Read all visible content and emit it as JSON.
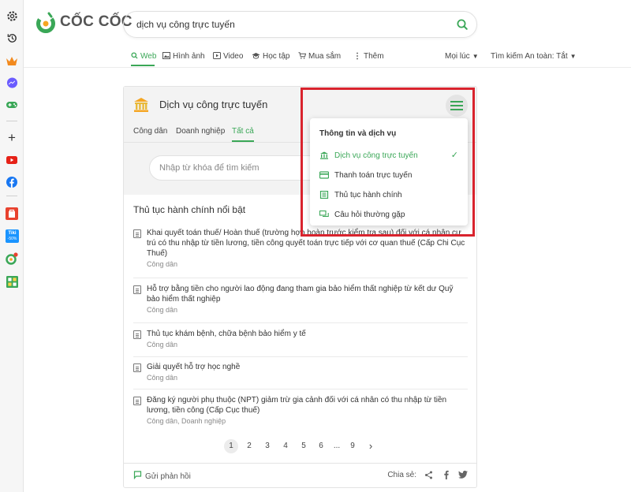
{
  "browser": {
    "rail_icons": [
      "gear-icon",
      "history-icon",
      "crown-icon",
      "messenger-icon",
      "game-icon",
      "plus-icon",
      "youtube-icon",
      "facebook-icon",
      "shop-icon",
      "tiki-icon",
      "coccoc-badge-icon",
      "calculator-icon"
    ],
    "tiki_label": "Tiki",
    "tiki_discount": "-50%"
  },
  "header": {
    "logo_text": "CỐC CỐC",
    "search_value": "dịch vụ công trực tuyến",
    "tabs": [
      {
        "label": "Web",
        "icon": "search-icon",
        "active": true
      },
      {
        "label": "Hình ảnh",
        "icon": "image-icon"
      },
      {
        "label": "Video",
        "icon": "play-icon"
      },
      {
        "label": "Học tập",
        "icon": "graduation-cap-icon"
      },
      {
        "label": "Mua sắm",
        "icon": "cart-icon"
      },
      {
        "label": "Thêm",
        "icon": "more-vertical-icon"
      }
    ],
    "time_filter": "Mọi lúc",
    "safe_search": "Tìm kiếm An toàn: Tắt"
  },
  "card": {
    "title": "Dịch vụ công trực tuyến",
    "subtabs": [
      "Công dân",
      "Doanh nghiệp",
      "Tất cả"
    ],
    "active_subtab": "Tất cả",
    "search_placeholder": "Nhập từ khóa để tìm kiếm",
    "section_title": "Thủ tục hành chính nổi bật",
    "items": [
      {
        "title": "Khai quyết toán thuế/ Hoàn thuế (trường hợp hoàn trước kiểm tra sau) đối với cá nhân cư trú có thu nhập từ tiền lương, tiền công quyết toán trực tiếp với cơ quan thuế (Cấp Chi Cục Thuế)",
        "sub": "Công dân"
      },
      {
        "title": "Hỗ trợ bằng tiền cho người lao động đang tham gia bảo hiểm thất nghiệp từ kết dư Quỹ bảo hiểm thất nghiệp",
        "sub": "Công dân"
      },
      {
        "title": "Thủ tục khám bệnh, chữa bệnh bảo hiểm y tế",
        "sub": "Công dân"
      },
      {
        "title": "Giải quyết hỗ trợ học nghề",
        "sub": "Công dân"
      },
      {
        "title": "Đăng ký người phụ thuộc (NPT) giảm trừ gia cảnh đối với cá nhân có thu nhập từ tiền lương, tiền công (Cấp Cục thuế)",
        "sub": "Công dân, Doanh nghiệp"
      }
    ],
    "pagination": [
      "1",
      "2",
      "3",
      "4",
      "5",
      "6",
      "...",
      "9",
      "›"
    ],
    "current_page": "1",
    "feedback_label": "Gửi phản hồi",
    "share_label": "Chia sẻ:",
    "share_icons": [
      "share-icon",
      "facebook-icon",
      "twitter-icon"
    ]
  },
  "dropdown": {
    "title": "Thông tin và dịch vụ",
    "items": [
      {
        "label": "Dịch vụ công trực tuyến",
        "icon": "government-building-icon",
        "active": true,
        "check": "✓"
      },
      {
        "label": "Thanh toán trực tuyến",
        "icon": "credit-card-icon"
      },
      {
        "label": "Thủ tục hành chính",
        "icon": "document-list-icon"
      },
      {
        "label": "Câu hỏi thường gặp",
        "icon": "chat-bubbles-icon"
      }
    ]
  },
  "colors": {
    "accent": "#3aa757",
    "highlight": "#d9232d"
  }
}
